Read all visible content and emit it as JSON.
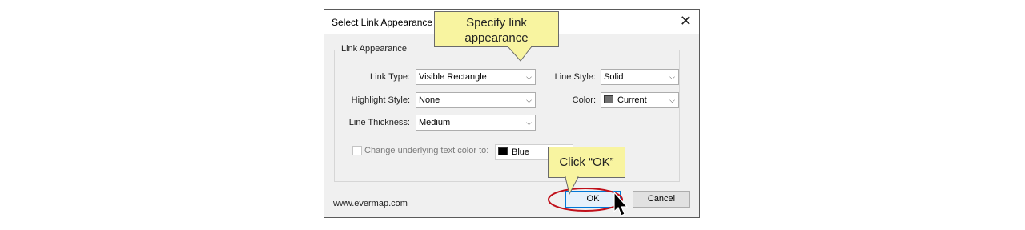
{
  "dialog": {
    "title": "Select Link Appearance",
    "close_glyph": "✕",
    "group_label": "Link Appearance",
    "link_type": {
      "label": "Link Type:",
      "value": "Visible Rectangle"
    },
    "highlight_style": {
      "label": "Highlight Style:",
      "value": "None"
    },
    "line_thickness": {
      "label": "Line Thickness:",
      "value": "Medium"
    },
    "line_style": {
      "label": "Line Style:",
      "value": "Solid"
    },
    "color": {
      "label": "Color:",
      "value": "Current",
      "swatch": "#707070"
    },
    "change_text_color": {
      "label": "Change underlying text color to:",
      "value": "Blue",
      "checked": false,
      "enabled": false,
      "swatch": "#000000"
    },
    "footer": "www.evermap.com",
    "ok_label": "OK",
    "cancel_label": "Cancel"
  },
  "callouts": {
    "appearance": {
      "line1": "Specify link",
      "line2": "appearance"
    },
    "ok": "Click “OK”"
  },
  "colors": {
    "callout_fill": "#f8f4a0",
    "highlight_ring": "#c0101a",
    "accent": "#0078d7"
  },
  "icons": {
    "dropdown": "chevron-down-icon",
    "cursor": "mouse-pointer-icon"
  }
}
